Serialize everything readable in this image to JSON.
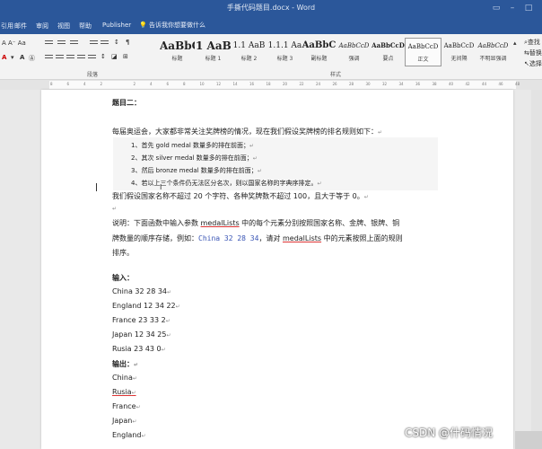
{
  "titlebar": {
    "title": "手撕代码题目.docx - Word"
  },
  "menu": {
    "items": [
      "引用",
      "邮件",
      "审阅",
      "视图",
      "帮助",
      "Publisher"
    ],
    "tell_me": "告诉我你想要做什么"
  },
  "ribbon": {
    "font_row_1": "A A⁻ Aa",
    "group_paragraph": "段落",
    "group_styles": "样式",
    "styles": [
      {
        "preview": "AaBbC",
        "name": "标题"
      },
      {
        "preview": "1 AaB",
        "name": "标题 1"
      },
      {
        "preview": "1.1 AaB",
        "name": "标题 2"
      },
      {
        "preview": "1.1.1 Aa",
        "name": "标题 3"
      },
      {
        "preview": "AaBbC",
        "name": "副标题"
      },
      {
        "preview": "AaBbCcD",
        "name": "强调"
      },
      {
        "preview": "AaBbCcD",
        "name": "要点"
      },
      {
        "preview": "AaBbCcD",
        "name": "正文"
      },
      {
        "preview": "AaBbCcD",
        "name": "无间隔"
      },
      {
        "preview": "AaBbCcD",
        "name": "不明显强调"
      }
    ],
    "right_tools": [
      "查找",
      "替换",
      "选择"
    ]
  },
  "ruler": {
    "ticks": [
      "8",
      "6",
      "4",
      "2",
      "",
      "2",
      "4",
      "6",
      "8",
      "10",
      "12",
      "14",
      "16",
      "18",
      "20",
      "22",
      "24",
      "26",
      "28",
      "30",
      "32",
      "34",
      "36",
      "38",
      "40",
      "42",
      "44",
      "46",
      "48"
    ]
  },
  "doc": {
    "heading": "题目二：",
    "intro": "每届奥运会，大家都非常关注奖牌榜的情况，现在我们假设奖牌榜的排名规则如下：",
    "rules": [
      "1、首先 gold medal 数量多的排在前面；",
      "2、其次 silver medal 数量多的排在前面；",
      "3、然后 bronze medal 数量多的排在前面；",
      "4、若以上三个条件仍无法区分名次，则以国家名称的字典序排定。"
    ],
    "constraint": "我们假设国家名称不超过 20 个字符、各种奖牌数不超过 100，且大于等于 0。",
    "desc_1a": "说明：下面函数中输入参数 ",
    "desc_1b": "medalLists",
    "desc_1c": " 中的每个元素分别按照国家名称、金牌、银牌、铜",
    "desc_2a": "牌数量的顺序存储，例如：",
    "desc_2b": "China 32 28 34",
    "desc_2c": "，请对 ",
    "desc_2d": "medalLists",
    "desc_2e": " 中的元素按照上面的规则",
    "desc_3": "排序。",
    "input_label": "输入：",
    "inputs": [
      "China 32 28 34",
      "England 12 34 22",
      "France 23 33 2",
      "Japan 12 34 25",
      "Rusia 23 43 0"
    ],
    "output_label": "输出：",
    "outputs": [
      "China",
      "Rusia",
      "France",
      "Japan",
      "England"
    ]
  },
  "watermark": "CSDN @什码情况"
}
